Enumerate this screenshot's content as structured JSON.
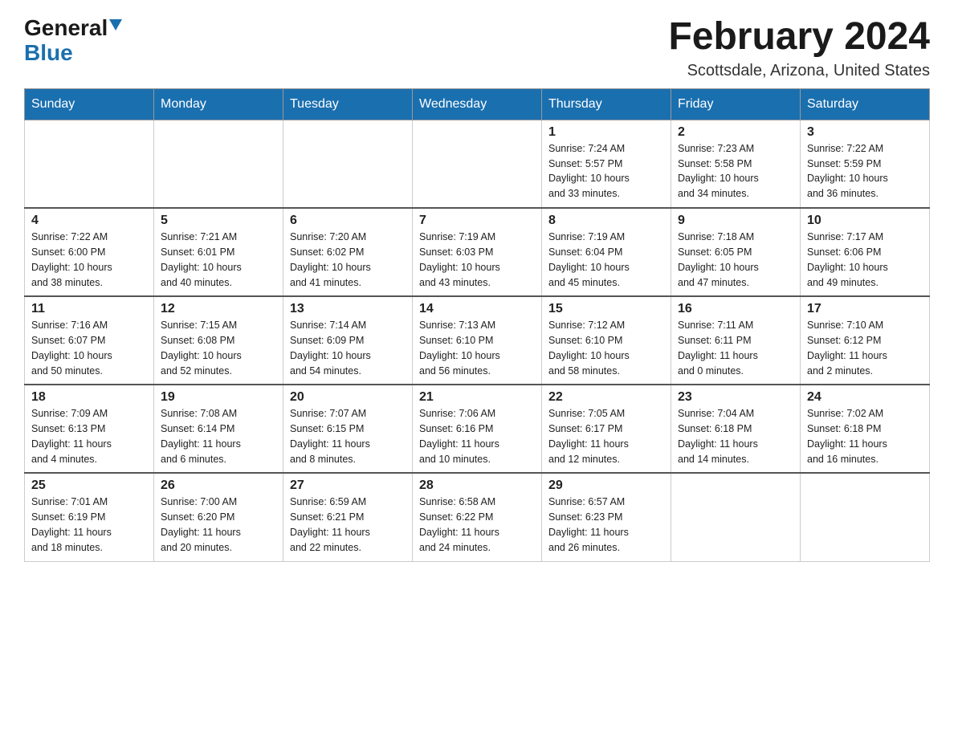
{
  "header": {
    "logo_general": "General",
    "logo_blue": "Blue",
    "month_title": "February 2024",
    "location": "Scottsdale, Arizona, United States"
  },
  "days_of_week": [
    "Sunday",
    "Monday",
    "Tuesday",
    "Wednesday",
    "Thursday",
    "Friday",
    "Saturday"
  ],
  "weeks": [
    {
      "days": [
        {
          "date": "",
          "info": ""
        },
        {
          "date": "",
          "info": ""
        },
        {
          "date": "",
          "info": ""
        },
        {
          "date": "",
          "info": ""
        },
        {
          "date": "1",
          "info": "Sunrise: 7:24 AM\nSunset: 5:57 PM\nDaylight: 10 hours\nand 33 minutes."
        },
        {
          "date": "2",
          "info": "Sunrise: 7:23 AM\nSunset: 5:58 PM\nDaylight: 10 hours\nand 34 minutes."
        },
        {
          "date": "3",
          "info": "Sunrise: 7:22 AM\nSunset: 5:59 PM\nDaylight: 10 hours\nand 36 minutes."
        }
      ]
    },
    {
      "days": [
        {
          "date": "4",
          "info": "Sunrise: 7:22 AM\nSunset: 6:00 PM\nDaylight: 10 hours\nand 38 minutes."
        },
        {
          "date": "5",
          "info": "Sunrise: 7:21 AM\nSunset: 6:01 PM\nDaylight: 10 hours\nand 40 minutes."
        },
        {
          "date": "6",
          "info": "Sunrise: 7:20 AM\nSunset: 6:02 PM\nDaylight: 10 hours\nand 41 minutes."
        },
        {
          "date": "7",
          "info": "Sunrise: 7:19 AM\nSunset: 6:03 PM\nDaylight: 10 hours\nand 43 minutes."
        },
        {
          "date": "8",
          "info": "Sunrise: 7:19 AM\nSunset: 6:04 PM\nDaylight: 10 hours\nand 45 minutes."
        },
        {
          "date": "9",
          "info": "Sunrise: 7:18 AM\nSunset: 6:05 PM\nDaylight: 10 hours\nand 47 minutes."
        },
        {
          "date": "10",
          "info": "Sunrise: 7:17 AM\nSunset: 6:06 PM\nDaylight: 10 hours\nand 49 minutes."
        }
      ]
    },
    {
      "days": [
        {
          "date": "11",
          "info": "Sunrise: 7:16 AM\nSunset: 6:07 PM\nDaylight: 10 hours\nand 50 minutes."
        },
        {
          "date": "12",
          "info": "Sunrise: 7:15 AM\nSunset: 6:08 PM\nDaylight: 10 hours\nand 52 minutes."
        },
        {
          "date": "13",
          "info": "Sunrise: 7:14 AM\nSunset: 6:09 PM\nDaylight: 10 hours\nand 54 minutes."
        },
        {
          "date": "14",
          "info": "Sunrise: 7:13 AM\nSunset: 6:10 PM\nDaylight: 10 hours\nand 56 minutes."
        },
        {
          "date": "15",
          "info": "Sunrise: 7:12 AM\nSunset: 6:10 PM\nDaylight: 10 hours\nand 58 minutes."
        },
        {
          "date": "16",
          "info": "Sunrise: 7:11 AM\nSunset: 6:11 PM\nDaylight: 11 hours\nand 0 minutes."
        },
        {
          "date": "17",
          "info": "Sunrise: 7:10 AM\nSunset: 6:12 PM\nDaylight: 11 hours\nand 2 minutes."
        }
      ]
    },
    {
      "days": [
        {
          "date": "18",
          "info": "Sunrise: 7:09 AM\nSunset: 6:13 PM\nDaylight: 11 hours\nand 4 minutes."
        },
        {
          "date": "19",
          "info": "Sunrise: 7:08 AM\nSunset: 6:14 PM\nDaylight: 11 hours\nand 6 minutes."
        },
        {
          "date": "20",
          "info": "Sunrise: 7:07 AM\nSunset: 6:15 PM\nDaylight: 11 hours\nand 8 minutes."
        },
        {
          "date": "21",
          "info": "Sunrise: 7:06 AM\nSunset: 6:16 PM\nDaylight: 11 hours\nand 10 minutes."
        },
        {
          "date": "22",
          "info": "Sunrise: 7:05 AM\nSunset: 6:17 PM\nDaylight: 11 hours\nand 12 minutes."
        },
        {
          "date": "23",
          "info": "Sunrise: 7:04 AM\nSunset: 6:18 PM\nDaylight: 11 hours\nand 14 minutes."
        },
        {
          "date": "24",
          "info": "Sunrise: 7:02 AM\nSunset: 6:18 PM\nDaylight: 11 hours\nand 16 minutes."
        }
      ]
    },
    {
      "days": [
        {
          "date": "25",
          "info": "Sunrise: 7:01 AM\nSunset: 6:19 PM\nDaylight: 11 hours\nand 18 minutes."
        },
        {
          "date": "26",
          "info": "Sunrise: 7:00 AM\nSunset: 6:20 PM\nDaylight: 11 hours\nand 20 minutes."
        },
        {
          "date": "27",
          "info": "Sunrise: 6:59 AM\nSunset: 6:21 PM\nDaylight: 11 hours\nand 22 minutes."
        },
        {
          "date": "28",
          "info": "Sunrise: 6:58 AM\nSunset: 6:22 PM\nDaylight: 11 hours\nand 24 minutes."
        },
        {
          "date": "29",
          "info": "Sunrise: 6:57 AM\nSunset: 6:23 PM\nDaylight: 11 hours\nand 26 minutes."
        },
        {
          "date": "",
          "info": ""
        },
        {
          "date": "",
          "info": ""
        }
      ]
    }
  ]
}
